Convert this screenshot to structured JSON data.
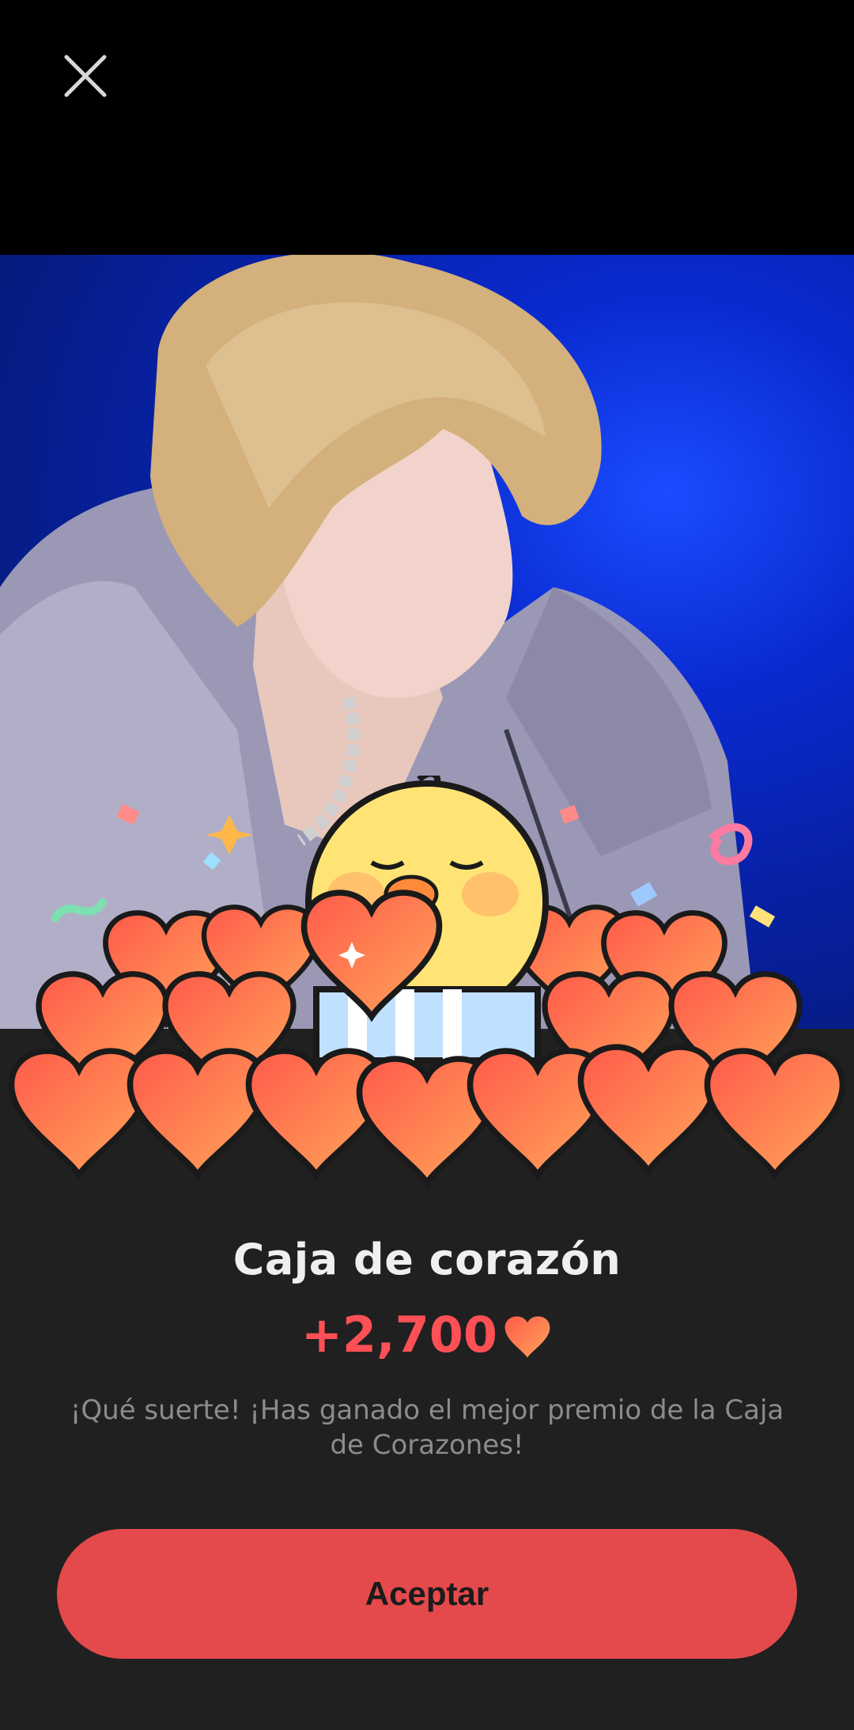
{
  "dialog": {
    "close_icon": "close-icon",
    "title": "Caja de corazón",
    "reward": {
      "amount_text": "+2,700",
      "icon": "heart-icon"
    },
    "message": "¡Qué suerte! ¡Has ganado el mejor premio de la Caja de Corazones!",
    "accept_label": "Aceptar"
  },
  "colors": {
    "background": "#202020",
    "accent": "#e44a4b",
    "reward_text": "#ff5055",
    "title_text": "#efefef",
    "message_text": "#8c8c8c"
  }
}
